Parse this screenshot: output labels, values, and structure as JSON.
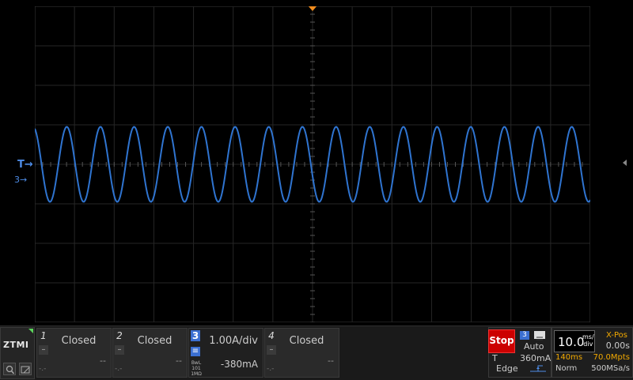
{
  "app": {
    "logo": "ZTMI"
  },
  "markers": {
    "trigger": "T",
    "channel3": "3"
  },
  "waveform": {
    "color": "#2f74d0",
    "cycles_visible": 16.5,
    "amplitude_div": 1.9,
    "offset_div": 0
  },
  "channels": [
    {
      "number": "1",
      "status": "Closed",
      "offset": "--",
      "bottom_left": "-.-"
    },
    {
      "number": "2",
      "status": "Closed",
      "offset": "--",
      "bottom_left": "-.-"
    },
    {
      "number": "3",
      "status": "1.00A/div",
      "offset": "-380mA",
      "coupling_line1": "BwL",
      "coupling_line2": "101",
      "coupling_line3": "1MΩ"
    },
    {
      "number": "4",
      "status": "Closed",
      "offset": "--",
      "bottom_left": "-.-"
    }
  ],
  "run_state": {
    "label": "Stop",
    "color": "#cc0000"
  },
  "trigger": {
    "source": "3",
    "mode": "Auto",
    "label_t": "T",
    "level": "360mA",
    "type": "Edge"
  },
  "timebase": {
    "value": "10.0",
    "unit_top": "ms/",
    "unit_bottom": "div",
    "xpos_label": "X-Pos",
    "xpos_value": "0.00s",
    "memory_depth": "140ms",
    "memory_points": "70.0Mpts",
    "acq_mode": "Norm",
    "sample_rate": "500MSa/s"
  },
  "colors": {
    "accent_orange": "#f2a900",
    "channel3_blue": "#3b6fd1",
    "grid": "#2a2a2a"
  }
}
